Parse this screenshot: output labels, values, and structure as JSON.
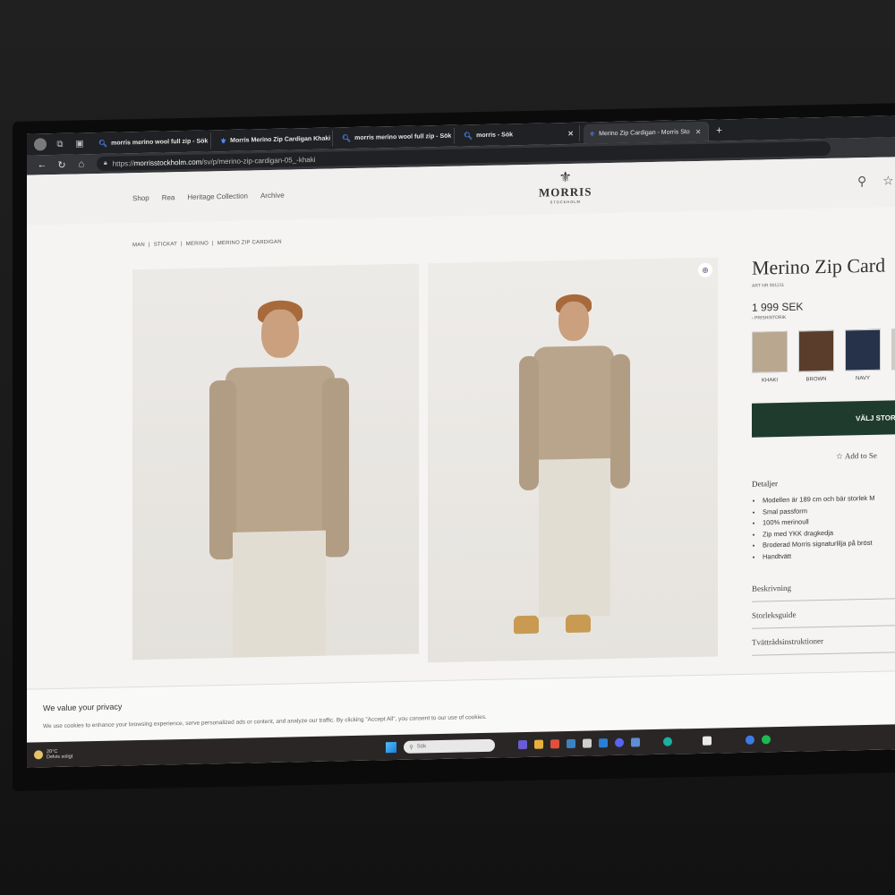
{
  "browser": {
    "tabs": [
      {
        "label": "morris merino wool full zip - Sök"
      },
      {
        "label": "Morris Merino Zip Cardigan Khaki"
      },
      {
        "label": "morris merino wool full zip - Sök"
      },
      {
        "label": "morris - Sök"
      },
      {
        "label": "Merino Zip Cardigan - Morris Sto"
      }
    ],
    "new_tab": "+",
    "url_prefix": "https://",
    "url_domain": "morrisstockholm.com",
    "url_path": "/sv/p/merino-zip-cardigan-05_-khaki"
  },
  "site": {
    "nav": [
      "Shop",
      "Rea",
      "Heritage Collection",
      "Archive"
    ],
    "logo": {
      "brand": "MORRIS",
      "sub": "STOCKHOLM"
    }
  },
  "breadcrumb": [
    "MAN",
    "|",
    "STICKAT",
    "|",
    "MERINO",
    "|",
    "MERINO ZIP CARDIGAN"
  ],
  "product": {
    "title": "Merino Zip Card",
    "art_nr": "ART NR 901211",
    "price": "1 999 SEK",
    "price_history": "› PRISHISTORIK",
    "colors": [
      {
        "label": "KHAKI",
        "color": "#b9a78f"
      },
      {
        "label": "BROWN",
        "color": "#5b3d2b"
      },
      {
        "label": "NAVY",
        "color": "#26324a"
      },
      {
        "label": "",
        "color": "#cfcac3"
      }
    ],
    "choose_size": "VÄLJ STOR",
    "wishlist": "Add to Se",
    "details_title": "Detaljer",
    "details": [
      "Modellen är 189 cm och bär storlek M",
      "Smal passform",
      "100% merinoull",
      "Zip med YKK dragkedja",
      "Broderad Morris signaturlilja på bröst",
      "Handtvätt"
    ],
    "accordions": [
      "Beskrivning",
      "Storleksguide",
      "Tvättrådsinstruktioner"
    ],
    "accent_color": "#1e3b2e"
  },
  "cookie": {
    "title": "We value your privacy",
    "text": "We use cookies to enhance your browsing experience, serve personalized ads or content, and analyze our traffic. By clicking \"Accept All\", you consent to our use of cookies."
  },
  "taskbar": {
    "temp": "20°C",
    "weather": "Delvis soligt",
    "search_placeholder": "Sök"
  }
}
